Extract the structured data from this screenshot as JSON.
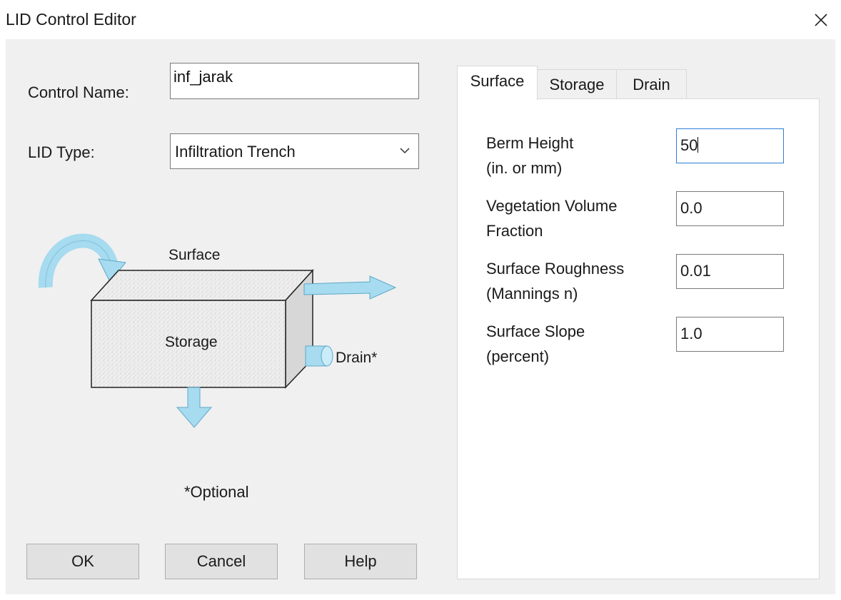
{
  "window": {
    "title": "LID Control Editor"
  },
  "control_name": {
    "label": "Control Name:",
    "value": "inf_jarak"
  },
  "lid_type": {
    "label": "LID Type:",
    "value": "Infiltration Trench"
  },
  "diagram": {
    "surface": "Surface",
    "storage": "Storage",
    "drain": "Drain*"
  },
  "optional_note": "*Optional",
  "buttons": {
    "ok": "OK",
    "cancel": "Cancel",
    "help": "Help"
  },
  "tabs": [
    {
      "label": "Surface",
      "active": true
    },
    {
      "label": "Storage",
      "active": false
    },
    {
      "label": "Drain",
      "active": false
    }
  ],
  "surface_params": [
    {
      "label_line1": "Berm Height",
      "label_line2": "(in. or mm)",
      "value": "50"
    },
    {
      "label_line1": "Vegetation Volume",
      "label_line2": "Fraction",
      "value": "0.0"
    },
    {
      "label_line1": "Surface Roughness",
      "label_line2": "(Mannings n)",
      "value": "0.01"
    },
    {
      "label_line1": "Surface Slope",
      "label_line2": "(percent)",
      "value": "1.0"
    }
  ],
  "colors": {
    "accent_focus": "#2b7fd3",
    "arrow": "#a6dbf0",
    "dialog_bg": "#f0f0f0"
  }
}
